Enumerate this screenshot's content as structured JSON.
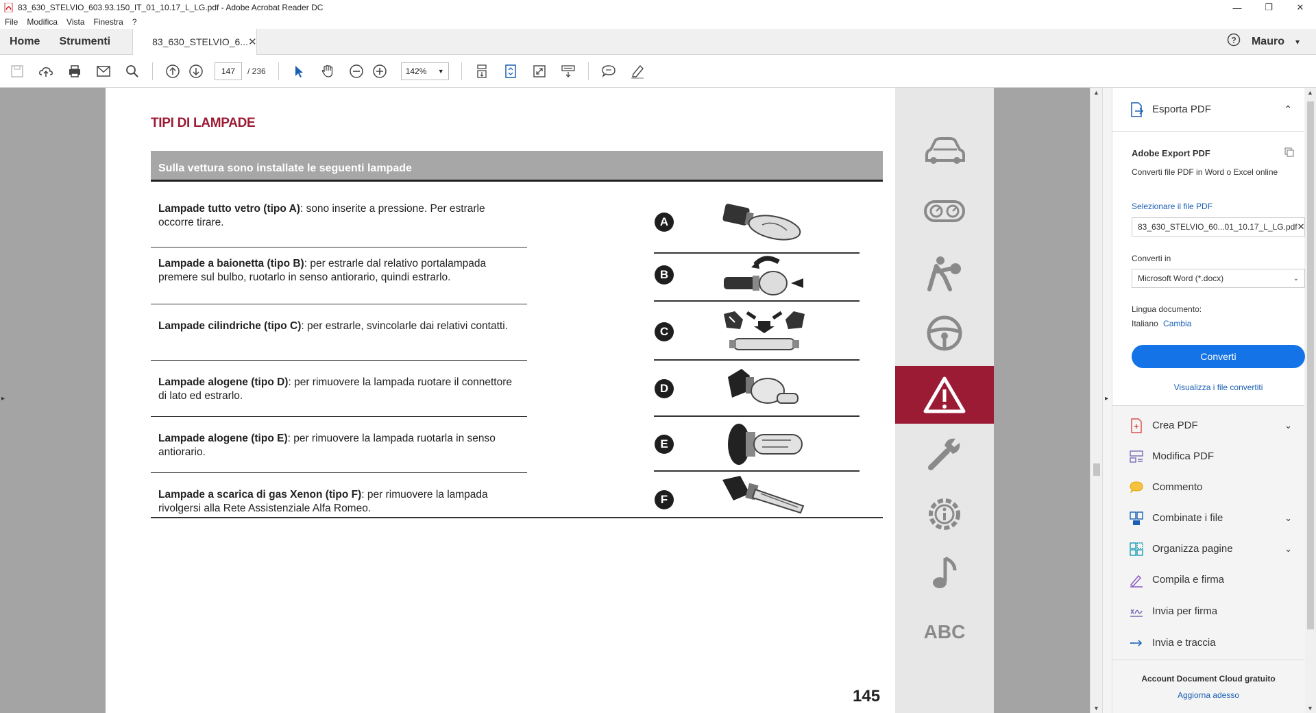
{
  "window": {
    "title": "83_630_STELVIO_603.93.150_IT_01_10.17_L_LG.pdf - Adobe Acrobat Reader DC"
  },
  "menu": [
    "File",
    "Modifica",
    "Vista",
    "Finestra",
    "?"
  ],
  "tabs": {
    "home": "Home",
    "tools": "Strumenti",
    "document": "83_630_STELVIO_6...",
    "user": "Mauro"
  },
  "toolbar": {
    "page_current": "147",
    "page_total": "/ 236",
    "zoom": "142%"
  },
  "document": {
    "title": "TIPI DI LAMPADE",
    "table_header": "Sulla vettura sono installate le seguenti lampade",
    "rows": [
      {
        "letter": "A",
        "bold": "Lampade tutto vetro (tipo A)",
        "text": ": sono inserite a pressione. Per estrarle occorre tirare."
      },
      {
        "letter": "B",
        "bold": "Lampade a baionetta (tipo B)",
        "text": ": per estrarle dal relativo portalampada premere sul bulbo, ruotarlo in senso antiorario, quindi estrarlo."
      },
      {
        "letter": "C",
        "bold": "Lampade cilindriche (tipo C)",
        "text": ": per estrarle, svincolarle dai relativi contatti."
      },
      {
        "letter": "D",
        "bold": "Lampade alogene (tipo D)",
        "text": ": per rimuovere la lampada ruotare il connettore di lato ed estrarlo."
      },
      {
        "letter": "E",
        "bold": "Lampade alogene (tipo E)",
        "text": ": per rimuovere la lampada ruotarla in senso antiorario."
      },
      {
        "letter": "F",
        "bold": "Lampade a scarica di gas Xenon (tipo F)",
        "text": ": per rimuovere la lampada rivolgersi alla Rete Assistenziale Alfa Romeo."
      }
    ],
    "page_number": "145",
    "side_abc": "ABC",
    "accent_color": "#9b1b35"
  },
  "right_panel": {
    "export_title": "Esporta PDF",
    "service_title": "Adobe Export PDF",
    "service_desc": "Converti file PDF in Word o Excel online",
    "select_label": "Selezionare il file PDF",
    "selected_file": "83_630_STELVIO_60...01_10.17_L_LG.pdf",
    "convert_to_label": "Converti in",
    "convert_to_value": "Microsoft Word (*.docx)",
    "language_label": "Lingua documento:",
    "language_value": "Italiano",
    "language_change": "Cambia",
    "convert_button": "Converti",
    "view_converted": "Visualizza i file convertiti",
    "tools": [
      {
        "label": "Crea PDF",
        "icon": "create-pdf-icon",
        "expandable": true
      },
      {
        "label": "Modifica PDF",
        "icon": "edit-pdf-icon",
        "expandable": false
      },
      {
        "label": "Commento",
        "icon": "comment-icon",
        "expandable": false
      },
      {
        "label": "Combinate i file",
        "icon": "combine-files-icon",
        "expandable": true
      },
      {
        "label": "Organizza pagine",
        "icon": "organize-pages-icon",
        "expandable": true
      },
      {
        "label": "Compila e firma",
        "icon": "fill-sign-icon",
        "expandable": false
      },
      {
        "label": "Invia per firma",
        "icon": "send-signature-icon",
        "expandable": false
      },
      {
        "label": "Invia e traccia",
        "icon": "send-track-icon",
        "expandable": false
      }
    ],
    "footer_title": "Account Document Cloud gratuito",
    "footer_link": "Aggiorna adesso"
  }
}
